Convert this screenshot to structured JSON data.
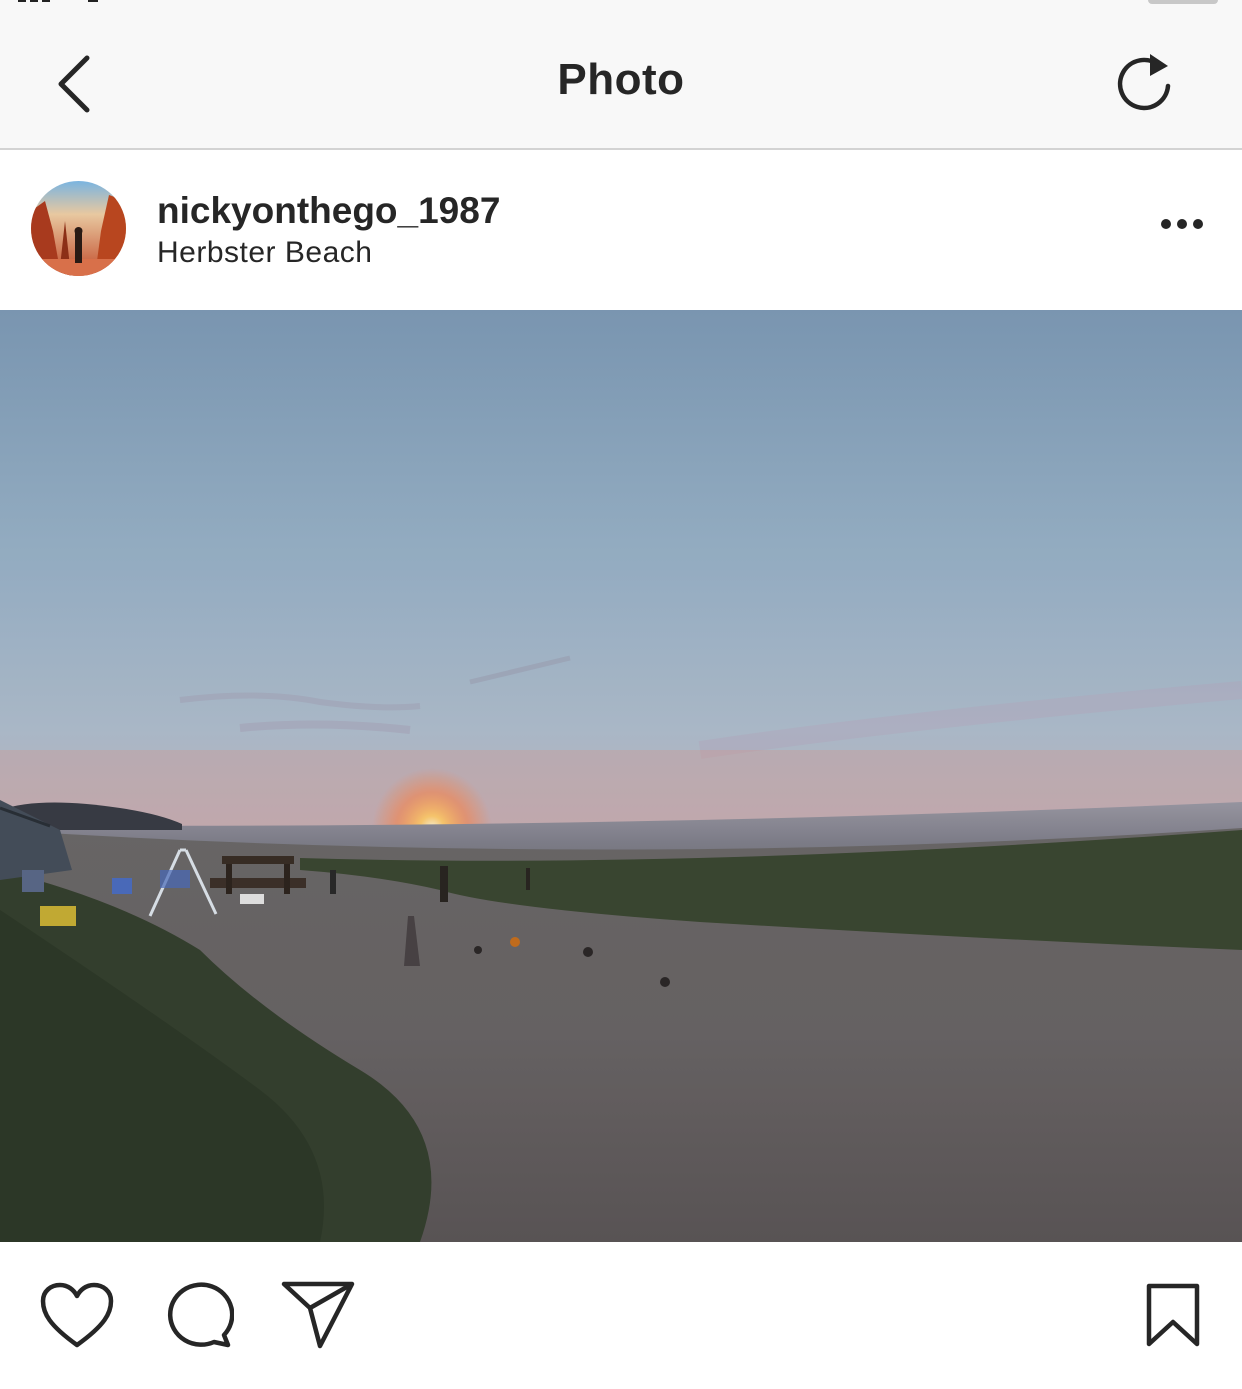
{
  "nav": {
    "title": "Photo",
    "back_icon": "chevron-left-icon",
    "refresh_icon": "refresh-icon"
  },
  "post": {
    "username": "nickyonthego_1987",
    "location": "Herbster Beach",
    "more_icon": "ellipsis-icon",
    "photo_subject": "sunset over lake from sandy beach campsite"
  },
  "actions": {
    "like_icon": "heart-icon",
    "comment_icon": "comment-icon",
    "share_icon": "send-icon",
    "save_icon": "bookmark-icon"
  },
  "colors": {
    "nav_background": "#f8f8f8",
    "text_primary": "#262626",
    "divider": "#d3d3d3"
  }
}
